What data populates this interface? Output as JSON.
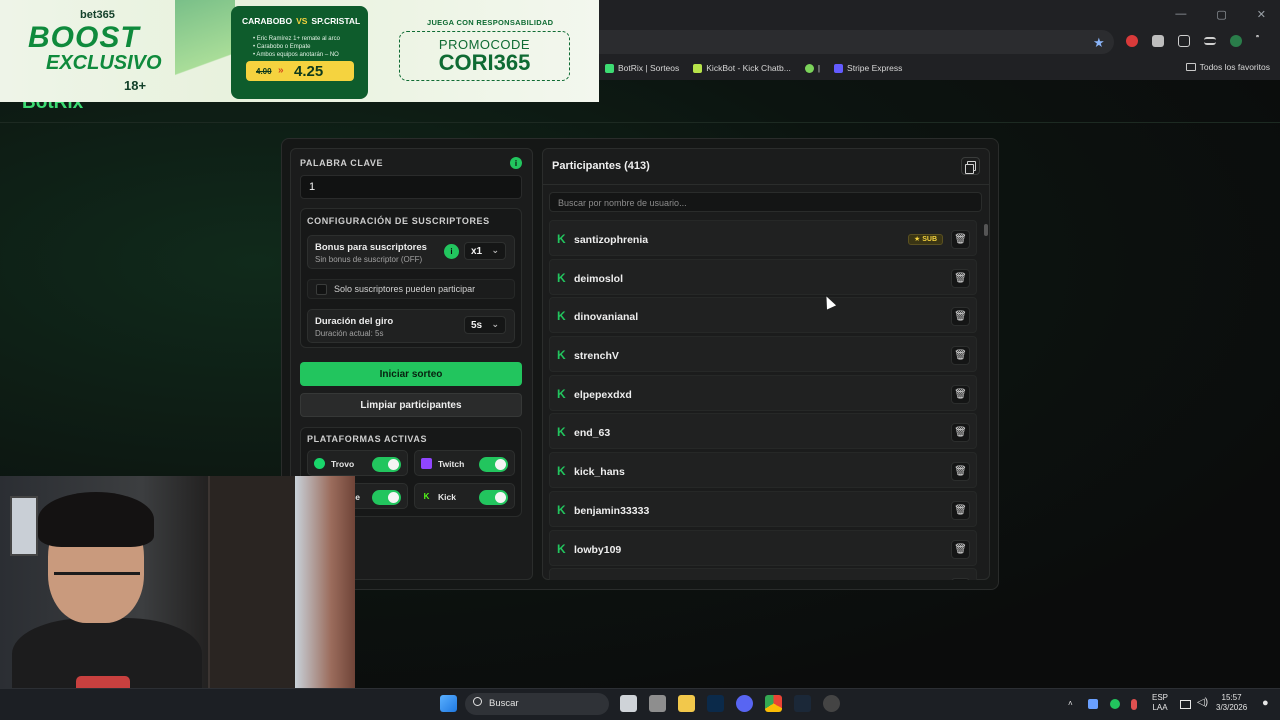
{
  "ad": {
    "brand": "bet365",
    "headline1": "BOOST",
    "headline2": "EXCLUSIVO",
    "age": "18+",
    "team_home": "CARABOBO",
    "vs": "VS",
    "team_away": "SP.CRISTAL",
    "line1": "• Eric Ramírez 1+ remate al arco",
    "line2": "• Carabobo o Empate",
    "line3": "• Ambos equipos anotarán – NO",
    "old_odds": "4.00",
    "new_odds": "4.25",
    "warning": "JUEGA CON RESPONSABILIDAD",
    "promo_label": "PROMOCODE",
    "promo_code": "CORI365"
  },
  "browser": {
    "bookmarks": [
      {
        "label": "BotRix | Sorteos",
        "color": "#3ddc73"
      },
      {
        "label": "KickBot - Kick Chatb...",
        "color": "#b7e34a"
      },
      {
        "label": "|",
        "color": "#7bd35a"
      },
      {
        "label": "Stripe Express",
        "color": "#635bff"
      }
    ],
    "favorites_label": "Todos los favoritos"
  },
  "site": {
    "logo": "BotRix"
  },
  "left": {
    "keyword_label": "PALABRA CLAVE",
    "keyword_value": "1",
    "info_glyph": "i",
    "sub_config_label": "CONFIGURACIÓN DE SUSCRIPTORES",
    "bonus_title": "Bonus para suscriptores",
    "bonus_sub": "Sin bonus de suscriptor (OFF)",
    "bonus_value": "x1",
    "sub_only_label": "Solo suscriptores pueden participar",
    "duration_title": "Duración del giro",
    "duration_sub": "Duración actual: 5s",
    "duration_value": "5s",
    "start_button": "Iniciar sorteo",
    "clear_button": "Limpiar participantes",
    "platforms_label": "PLATAFORMAS ACTIVAS",
    "platforms": [
      {
        "name": "Trovo",
        "enabled": true,
        "color": "#19d66b"
      },
      {
        "name": "Twitch",
        "enabled": true,
        "color": "#9146ff"
      },
      {
        "name": "be",
        "enabled": true,
        "color": "#ff0000"
      },
      {
        "name": "Kick",
        "enabled": true,
        "color": "#53fc18"
      }
    ]
  },
  "right": {
    "title": "Participantes (413)",
    "search_placeholder": "Buscar por nombre de usuario...",
    "participants": [
      {
        "name": "santizophrenia",
        "badge": "★ SUB"
      },
      {
        "name": "deimoslol",
        "badge": ""
      },
      {
        "name": "dinovanianal",
        "badge": ""
      },
      {
        "name": "strenchV",
        "badge": ""
      },
      {
        "name": "elpepexdxd",
        "badge": ""
      },
      {
        "name": "end_63",
        "badge": ""
      },
      {
        "name": "kick_hans",
        "badge": ""
      },
      {
        "name": "benjamin33333",
        "badge": ""
      },
      {
        "name": "lowby109",
        "badge": ""
      },
      {
        "name": "",
        "badge": ""
      }
    ]
  },
  "taskbar": {
    "search_label": "Buscar",
    "lang_top": "ESP",
    "lang_bottom": "LAA",
    "time": "15:57",
    "date": "3/3/2026"
  }
}
